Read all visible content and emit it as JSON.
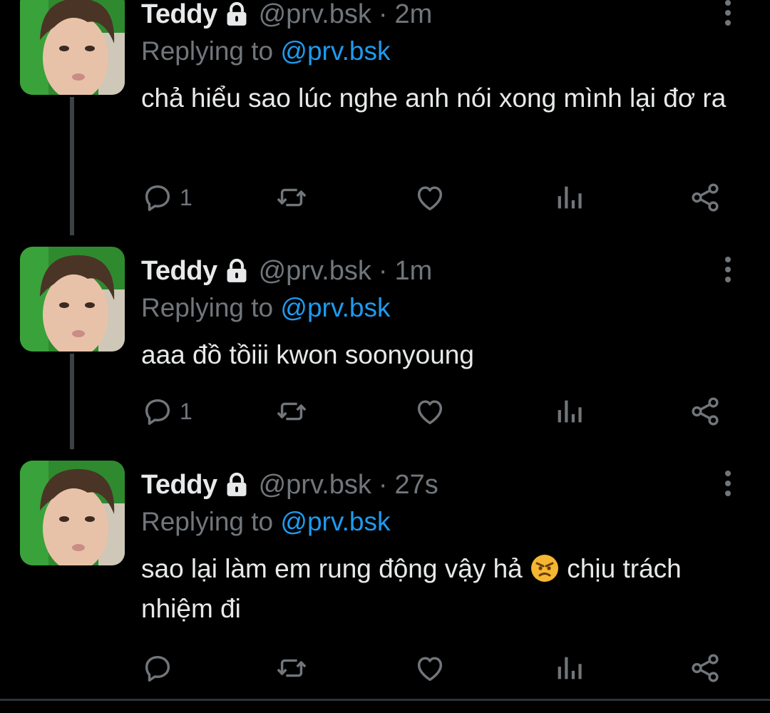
{
  "colors": {
    "background": "#000000",
    "text": "#e7e9ea",
    "muted": "#71767b",
    "mention": "#1d9bf0",
    "thread_line": "#3e4144"
  },
  "tweets": [
    {
      "name": "Teddy",
      "handle": "@prv.bsk",
      "separator": "·",
      "time": "2m",
      "replying_prefix": "Replying to",
      "replying_to": "@prv.bsk",
      "text": "chả hiểu sao lúc nghe anh nói xong mình lại đơ ra",
      "reply_count": "1"
    },
    {
      "name": "Teddy",
      "handle": "@prv.bsk",
      "separator": "·",
      "time": "1m",
      "replying_prefix": "Replying to",
      "replying_to": "@prv.bsk",
      "text": "aaa đồ tồiii kwon soonyoung",
      "reply_count": "1"
    },
    {
      "name": "Teddy",
      "handle": "@prv.bsk",
      "separator": "·",
      "time": "27s",
      "replying_prefix": "Replying to",
      "replying_to": "@prv.bsk",
      "text_before_emoji": "sao lại làm em rung động vậy hả ",
      "emoji": "angry-face-emoji",
      "text_after_emoji": " chịu trách nhiệm đi",
      "reply_count": ""
    }
  ],
  "icons": {
    "protected": "lock-icon",
    "more": "more-vertical-icon",
    "reply": "reply-bubble-icon",
    "retweet": "retweet-icon",
    "like": "heart-icon",
    "views": "views-chart-icon",
    "share": "share-icon"
  }
}
